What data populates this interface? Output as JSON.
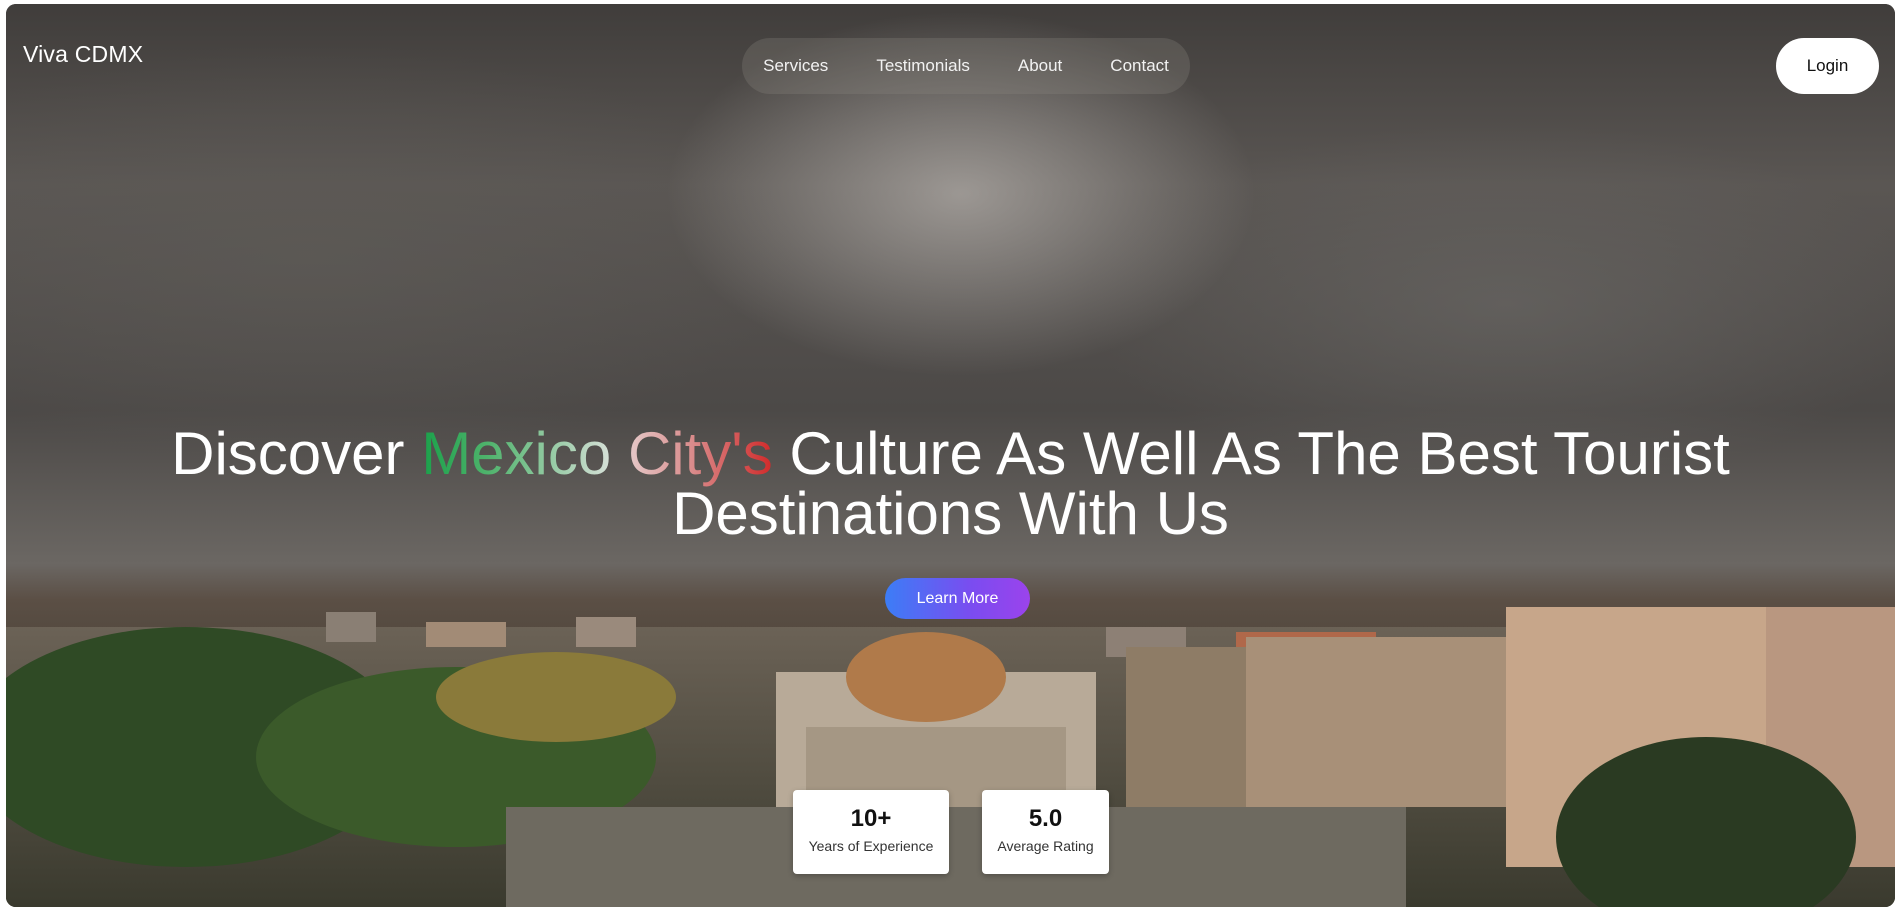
{
  "brand": "Viva CDMX",
  "nav": {
    "items": [
      "Services",
      "Testimonials",
      "About",
      "Contact"
    ]
  },
  "login_label": "Login",
  "hero": {
    "headline_part1": "Discover ",
    "headline_mexico": "Mexico",
    "headline_space": " ",
    "headline_citys": "City's",
    "headline_part2": " Culture As Well As The Best Tourist",
    "headline_line2": "Destinations With Us",
    "cta_label": "Learn More"
  },
  "stats": [
    {
      "value": "10+",
      "label": "Years of Experience"
    },
    {
      "value": "5.0",
      "label": "Average Rating"
    }
  ],
  "colors": {
    "mexico_green": "#1aa04a",
    "citys_red": "#d12a2a",
    "cta_start": "#3c7df6",
    "cta_end": "#9b43ec"
  }
}
